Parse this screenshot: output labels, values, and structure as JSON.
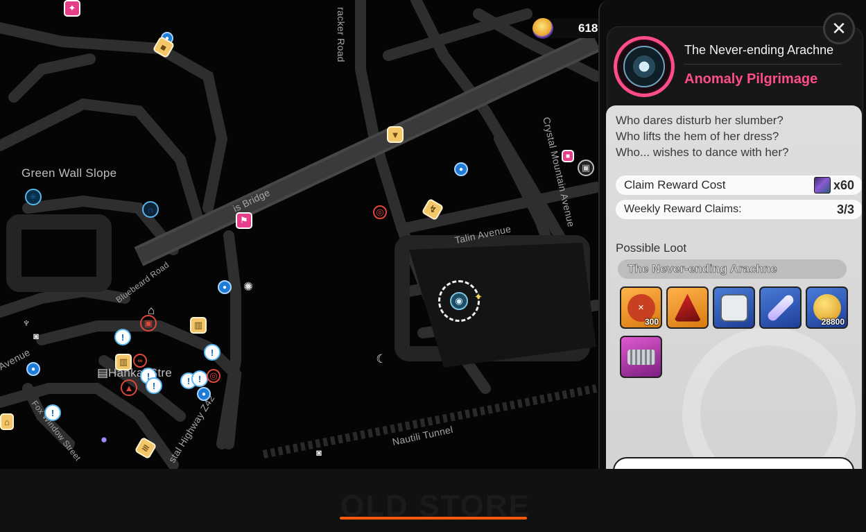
{
  "map": {
    "labels": {
      "green_wall_slope": "Green Wall Slope",
      "bridge": "is Bridge",
      "tracker_road": "racker Road",
      "crystal_mountain_avenue": "Crystal Mountain Avenue",
      "talin_avenue": "Talin Avenue",
      "bluebeard_road": "Bluebeard Road",
      "hankai_street": "Hankai Stre",
      "avenue": "Avenue",
      "fox_window_street": "Fox Window Street",
      "coastal_highway": "stal Highway Z42",
      "nautili_tunnel": "Nautili Tunnel"
    }
  },
  "currency": {
    "value": "618",
    "icon": "polychrome-icon"
  },
  "panel": {
    "close_label": "✕",
    "title": "The Never-ending Arachne",
    "subtitle": "Anomaly Pilgrimage",
    "accent": "#ff4d8a",
    "description": [
      "Who dares disturb her slumber?",
      "Who lifts the hem of her dress?",
      "Who... wishes to dance with her?"
    ],
    "claim_cost_label": "Claim Reward Cost",
    "claim_cost_value": "x60",
    "weekly_label": "Weekly Reward Claims:",
    "weekly_value": "3/3",
    "loot_label": "Possible Loot",
    "loot_name": "The Never-ending Arachne",
    "items": [
      {
        "name": "hunter-token-icon",
        "rarity": "orange",
        "qty": "300"
      },
      {
        "name": "red-cloak-icon",
        "rarity": "orange",
        "qty": ""
      },
      {
        "name": "data-card-icon",
        "rarity": "blue",
        "qty": ""
      },
      {
        "name": "tube-icon",
        "rarity": "blue",
        "qty": ""
      },
      {
        "name": "gold-coin-icon",
        "rarity": "blue",
        "qty": "28800"
      },
      {
        "name": "metal-coil-icon",
        "rarity": "purple",
        "qty": ""
      }
    ]
  },
  "bottom": {
    "store_text": "OLD STORE",
    "accent": "#ff5a0a"
  }
}
